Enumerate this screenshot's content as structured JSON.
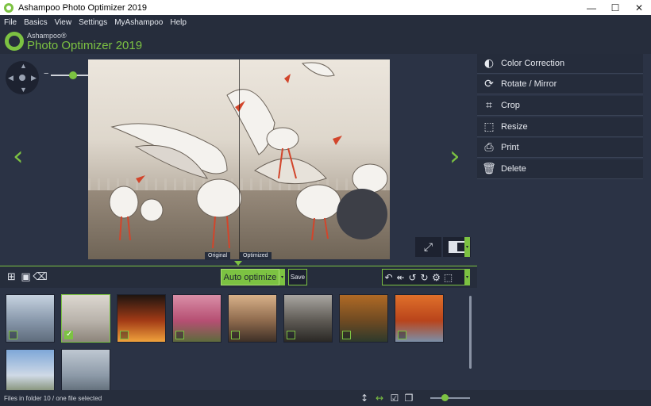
{
  "window": {
    "title": "Ashampoo Photo Optimizer 2019",
    "minimize": "—",
    "maximize": "☐",
    "close": "✕"
  },
  "menu": [
    "File",
    "Basics",
    "View",
    "Settings",
    "MyAshampoo",
    "Help"
  ],
  "brand": {
    "small": "Ashampoo®",
    "big": "Photo Optimizer 2019"
  },
  "viewer": {
    "zoom_minus": "−",
    "zoom_plus": "+",
    "zoom_level": 0.4,
    "prev_arrow": "‹",
    "next_arrow": "›",
    "label_original": "Original",
    "label_optimized": "Optimized",
    "fullscreen_glyph": "⤢"
  },
  "panel": {
    "items": [
      {
        "icon": "color-correction-icon",
        "glyph": "◐",
        "label": "Color Correction"
      },
      {
        "icon": "rotate-icon",
        "glyph": "⟳",
        "label": "Rotate / Mirror"
      },
      {
        "icon": "crop-icon",
        "glyph": "⌗",
        "label": "Crop"
      },
      {
        "icon": "resize-icon",
        "glyph": "⬚",
        "label": "Resize"
      },
      {
        "icon": "print-icon",
        "glyph": "⎙",
        "label": "Print"
      },
      {
        "icon": "trash-icon",
        "glyph": "🗑",
        "label": "Delete"
      }
    ]
  },
  "toolbar": {
    "auto_optimize": "Auto optimize",
    "save": "Save",
    "caret": "▾"
  },
  "thumbnails": [
    {
      "name": "skyscrapers",
      "checked": false,
      "colors": [
        "#c7d3e0",
        "#8898ab",
        "#5f6c7c"
      ]
    },
    {
      "name": "seagulls",
      "checked": true,
      "colors": [
        "#dcd7d0",
        "#b9b3ab",
        "#8d857b"
      ]
    },
    {
      "name": "city-night",
      "checked": false,
      "colors": [
        "#1e1510",
        "#a33b16",
        "#f0a23c"
      ]
    },
    {
      "name": "blossoms",
      "checked": false,
      "colors": [
        "#d98fa7",
        "#b64f73",
        "#5d6b3c"
      ]
    },
    {
      "name": "bridge-sunset",
      "checked": false,
      "colors": [
        "#d8b189",
        "#8e6a4d",
        "#3e3027"
      ]
    },
    {
      "name": "storm-clouds",
      "checked": false,
      "colors": [
        "#a9a6a1",
        "#5e5a54",
        "#2a2825"
      ]
    },
    {
      "name": "autumn-temple",
      "checked": false,
      "colors": [
        "#b06a25",
        "#6f4a22",
        "#2e3a2b"
      ]
    },
    {
      "name": "autumn-tree",
      "checked": false,
      "colors": [
        "#e0702a",
        "#b9441b",
        "#7b8fa8"
      ]
    },
    {
      "name": "sky-landscape",
      "checked": false,
      "colors": [
        "#7ea7d8",
        "#cfd9e6",
        "#6d7b54"
      ]
    },
    {
      "name": "building",
      "checked": false,
      "colors": [
        "#bfc8d2",
        "#8d9aa8",
        "#54606b"
      ]
    }
  ],
  "status": {
    "text": "Files in folder 10 / one file selected",
    "thumb_size_level": 0.35
  },
  "accent": "#7cc242"
}
